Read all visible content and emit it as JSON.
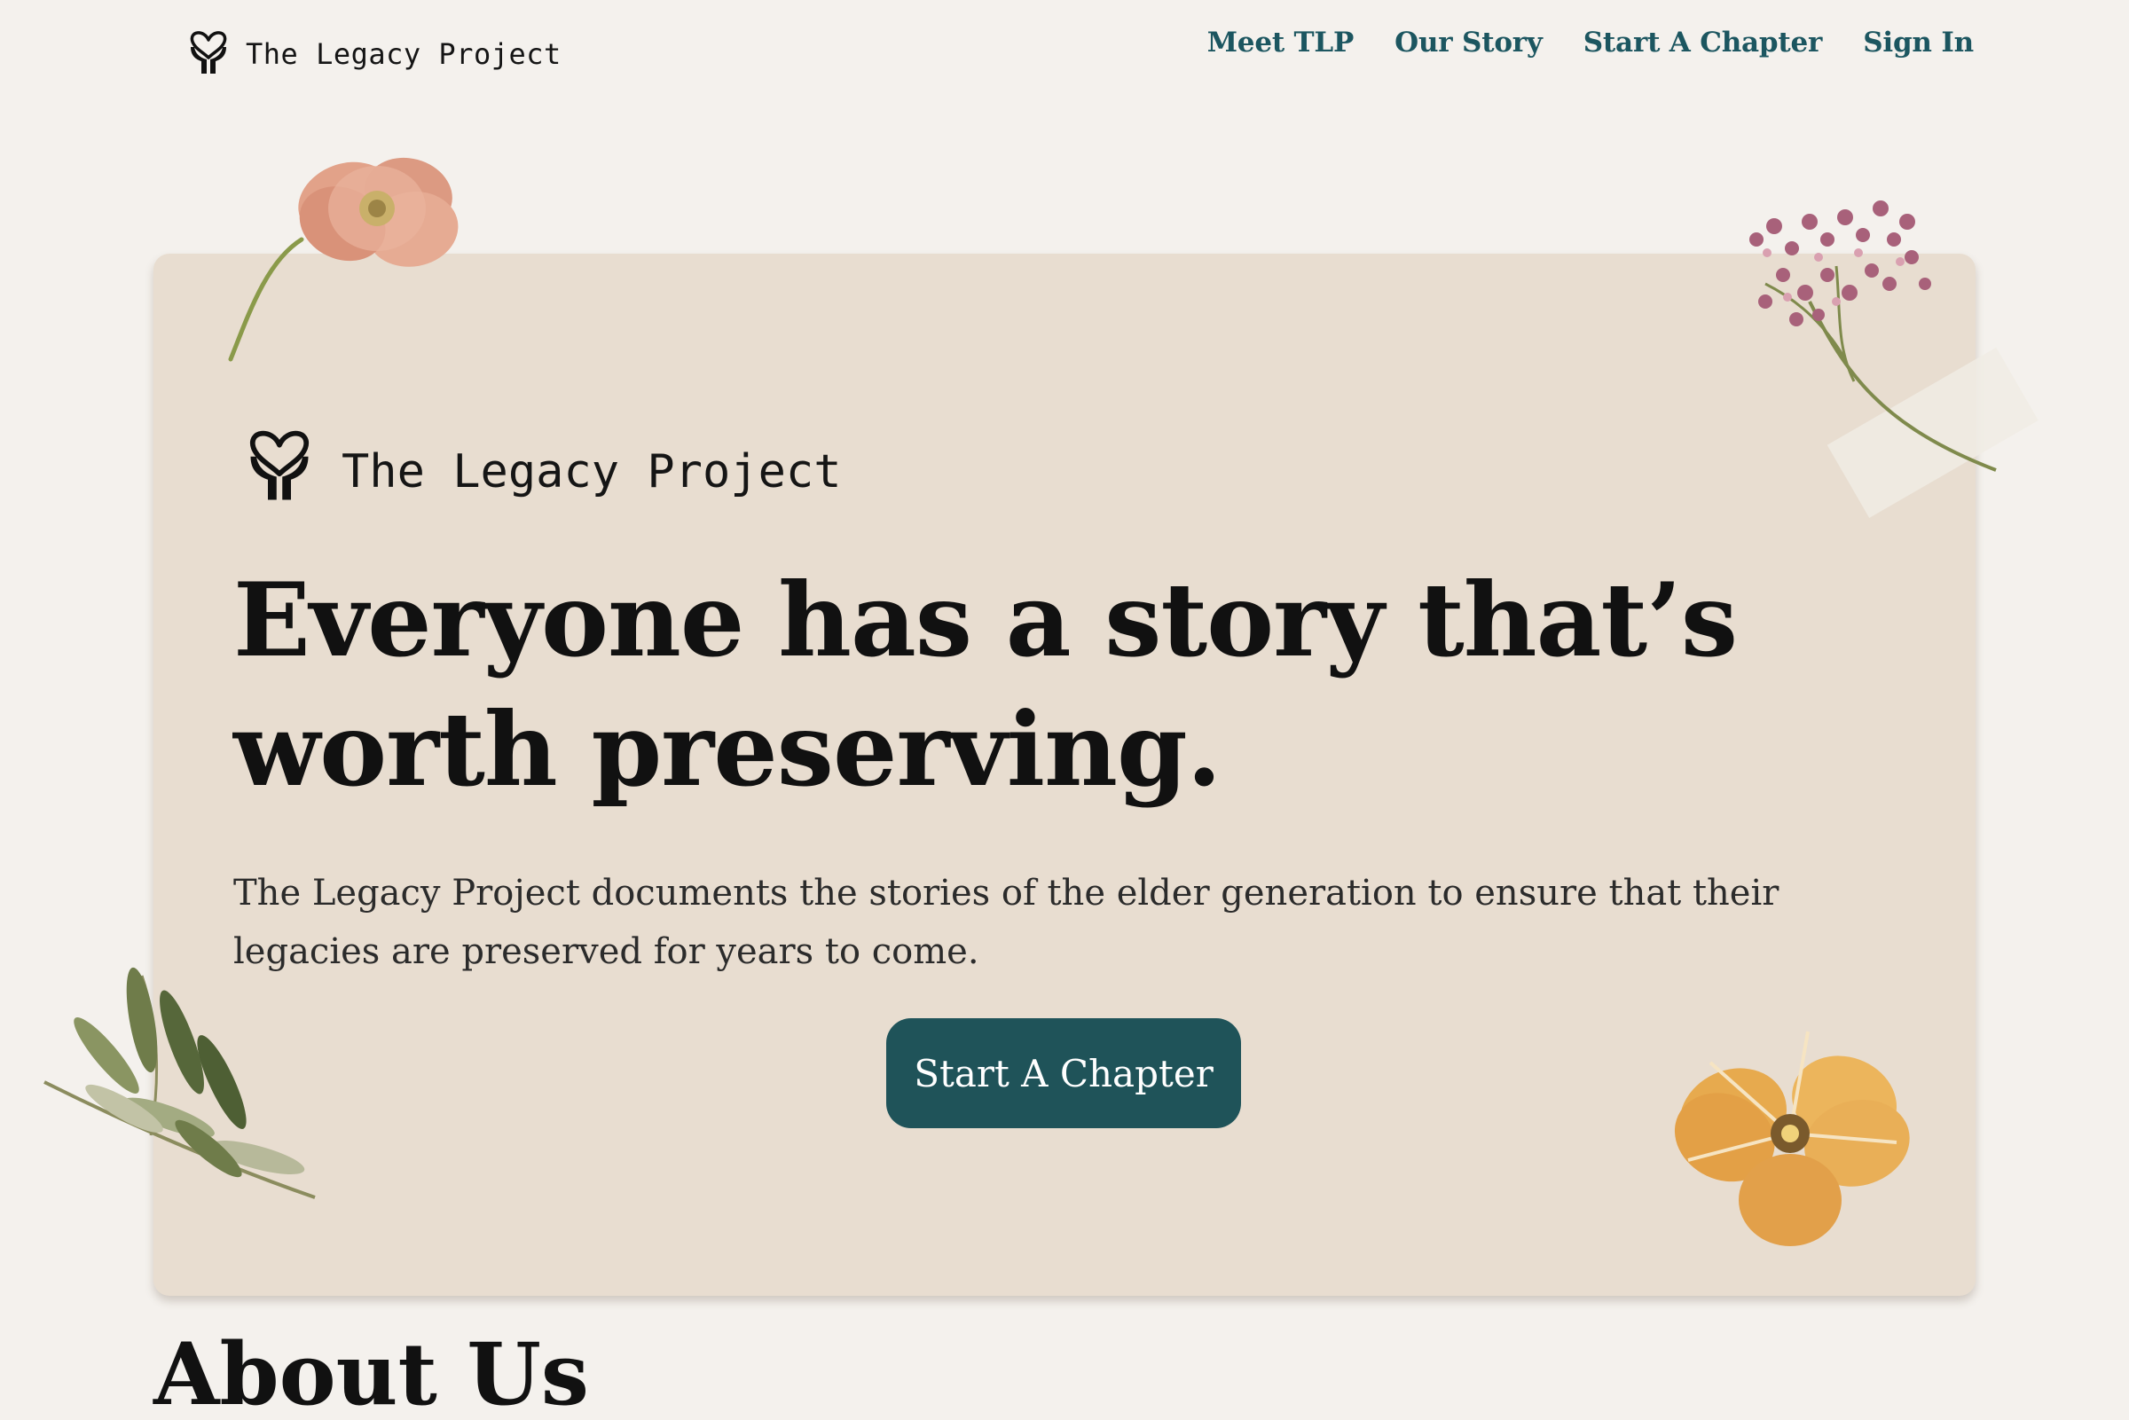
{
  "brand": {
    "name": "The Legacy Project",
    "logo_icon": "heart-hands-icon"
  },
  "nav": {
    "items": [
      {
        "label": "Meet TLP"
      },
      {
        "label": "Our Story"
      },
      {
        "label": "Start A Chapter"
      },
      {
        "label": "Sign In"
      }
    ]
  },
  "hero": {
    "brand_name": "The Legacy Project",
    "headline": "Everyone has a story that’s worth preserving.",
    "description": "The Legacy Project documents the stories of the elder generation to ensure that their legacies are preserved for years to come.",
    "cta_label": "Start A Chapter"
  },
  "about": {
    "heading": "About Us"
  },
  "colors": {
    "page_background": "#f4f1ed",
    "card_background": "#e8ddd0",
    "accent_teal": "#1f5359",
    "nav_link": "#1c5660",
    "text_dark": "#111111"
  },
  "decorations": [
    "pressed-poppy-icon",
    "pressed-flower-cluster-icon",
    "olive-sprig-icon",
    "pressed-pansy-icon"
  ]
}
